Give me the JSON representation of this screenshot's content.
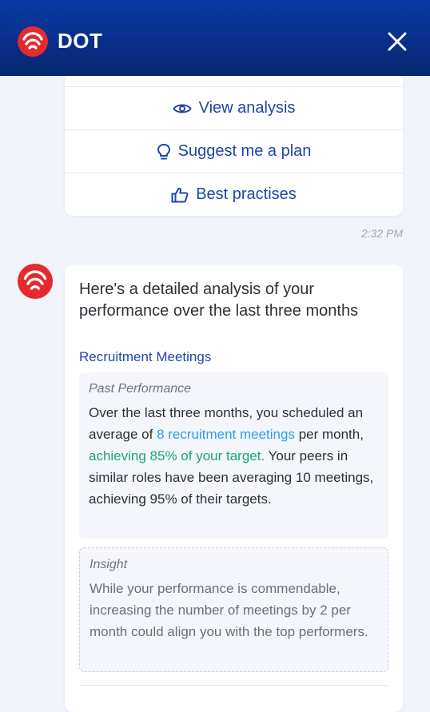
{
  "header": {
    "title": "DOT",
    "close_icon": "close-icon",
    "colors": {
      "gradient_top": "#0a3aa8",
      "gradient_bottom": "#07266f",
      "logo_red": "#e52a2f"
    }
  },
  "options": [
    {
      "label": "View analysis",
      "icon": "eye-icon"
    },
    {
      "label": "Suggest me a plan",
      "icon": "lightbulb-icon"
    },
    {
      "label": "Best practises",
      "icon": "thumbs-up-icon"
    }
  ],
  "timestamp": "2:32 PM",
  "message": {
    "intro": "Here's a detailed analysis of your performance over the last three months",
    "section_title": "Recruitment Meetings",
    "past_performance": {
      "label": "Past Performance",
      "text_1": "Over the last three months, you scheduled an average of ",
      "highlight_meetings": "8 recruitment meetings",
      "text_2": " per month, ",
      "highlight_target": "achieving 85% of your target.",
      "text_3": " Your peers in similar roles have been averaging 10 meetings, achieving 95% of their targets."
    },
    "insight": {
      "label": "Insight",
      "text": "While your performance is commendable, increasing the number of meetings by 2 per month could align you with the top performers."
    }
  }
}
